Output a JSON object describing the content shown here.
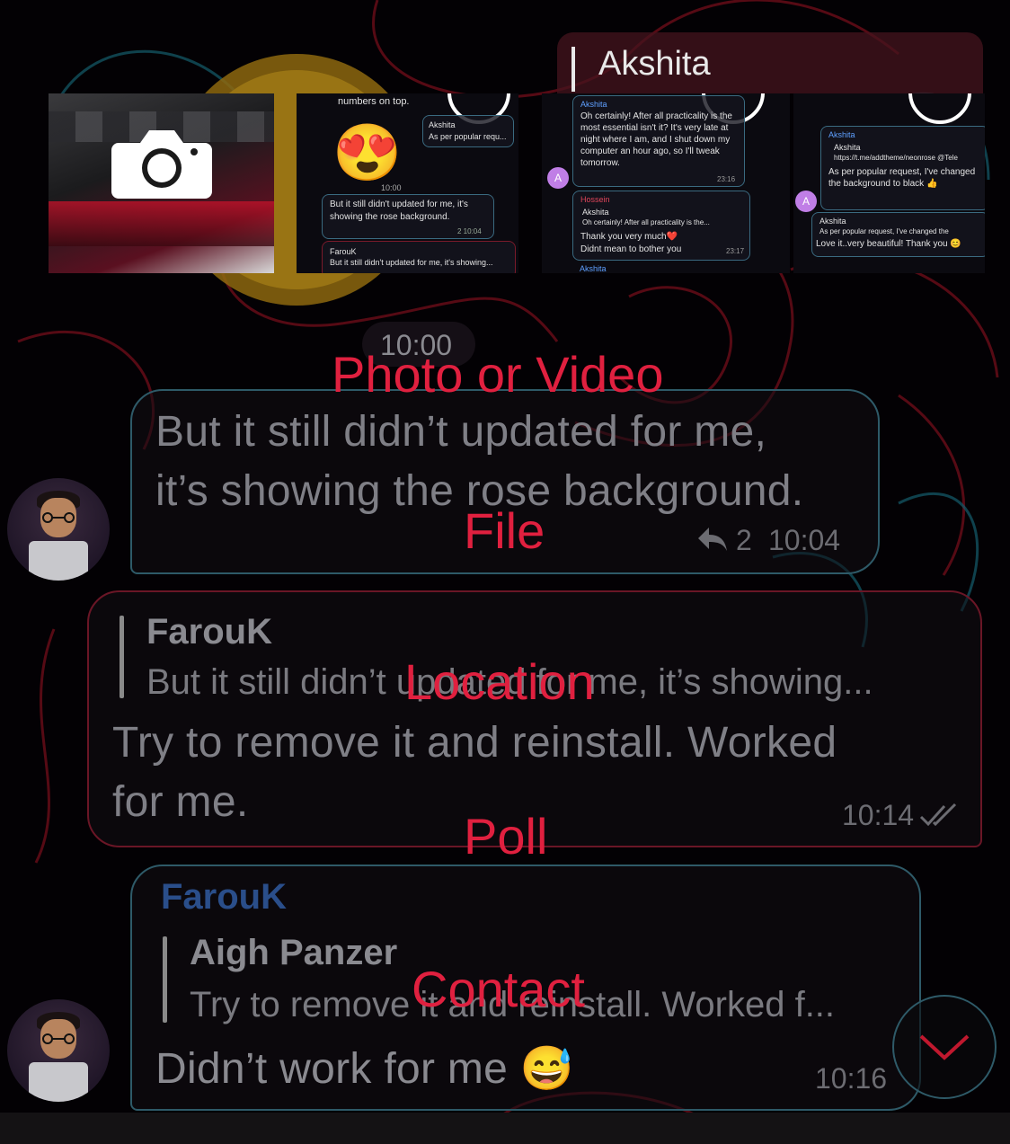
{
  "attach_sheet": {
    "reply_to_name": "Akshita",
    "options": [
      "Photo or Video",
      "File",
      "Location",
      "Poll",
      "Contact"
    ]
  },
  "gallery": {
    "tile2": {
      "top_text": "numbers on top.",
      "quote_name": "Akshita",
      "quote_text": "As per popular requ...",
      "emoji": "😍",
      "time1": "10:00",
      "msg": "But it still didn't updated for me, it's showing the rose background.",
      "meta": "2 10:04",
      "quote2_name": "FarouK",
      "quote2_text": "But it still didn't updated for me, it's showing..."
    },
    "tile3": {
      "name1": "Akshita",
      "text1": "Oh certainly! After all practicality is the most essential isn't it? It's very late at night where I am, and I shut down my computer an hour ago, so I'll tweak tomorrow.",
      "time1": "23:16",
      "name2": "Hossein",
      "quote_name": "Akshita",
      "quote_text": "Oh certainly! After all practicality is the...",
      "text2": "Thank you very much❤️",
      "text3": "Didnt mean to bother you",
      "time2": "23:17",
      "name3": "Akshita",
      "avatar_letter": "A"
    },
    "tile4": {
      "name1": "Akshita",
      "quote_name": "Akshita",
      "quote_text": "https://t.me/addtheme/neonrose @Tele",
      "text1": "As per popular request, I've changed the background to black 👍",
      "quote2_name": "Akshita",
      "quote2_text": "As per popular request, I've changed the",
      "text2": "Love it..very beautiful! Thank you 😊",
      "avatar_letter": "A"
    }
  },
  "chat": {
    "date_chip": "10:00",
    "messages": [
      {
        "text_line1": "But it still didn’t updated for me,",
        "text_line2": "it’s showing the rose background.",
        "replies": "2",
        "time": "10:04"
      },
      {
        "quote_name": "FarouK",
        "quote_text": "But it still didn’t updated for me, it’s showing...",
        "text_line1": "Try to remove it and reinstall. Worked",
        "text_line2": "for me.",
        "time": "10:14"
      },
      {
        "sender": "FarouK",
        "quote_name": "Aigh Panzer",
        "quote_text": "Try to remove it and reinstall. Worked f...",
        "text": "Didn’t work for me 😅",
        "time": "10:16"
      }
    ]
  },
  "colors": {
    "accent": "#e0203f",
    "incoming_border": "#2e5a68",
    "outgoing_border": "#6a1626"
  },
  "icons": [
    "camera-icon",
    "reply-arrow-icon",
    "double-check-icon",
    "chevron-down-icon"
  ]
}
